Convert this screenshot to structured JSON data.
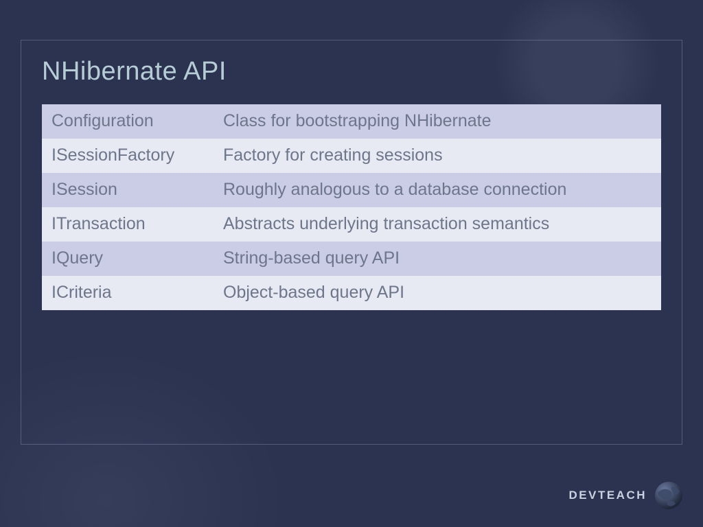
{
  "slide": {
    "title": "NHibernate API",
    "rows": [
      {
        "name": "Configuration",
        "desc": "Class for bootstrapping NHibernate"
      },
      {
        "name": "ISessionFactory",
        "desc": "Factory for creating sessions"
      },
      {
        "name": "ISession",
        "desc": "Roughly analogous to a database connection"
      },
      {
        "name": "ITransaction",
        "desc": "Abstracts underlying transaction semantics"
      },
      {
        "name": "IQuery",
        "desc": "String-based query API"
      },
      {
        "name": "ICriteria",
        "desc": "Object-based query API"
      }
    ]
  },
  "footer": {
    "brand": "DEVTEACH"
  }
}
